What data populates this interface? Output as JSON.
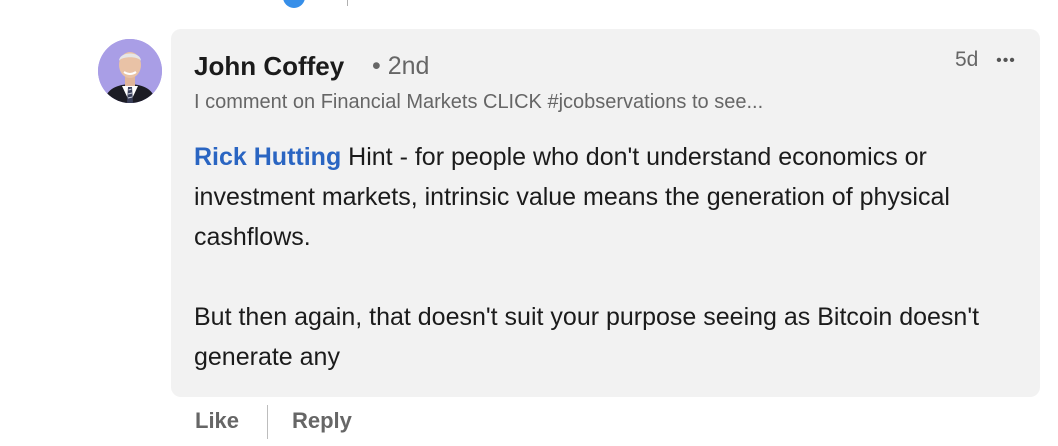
{
  "comment": {
    "author_name": "John Coffey",
    "connection_degree": "• 2nd",
    "headline": "I comment on Financial Markets CLICK #jcobservations to see...",
    "timestamp": "5d",
    "more_icon": "•••",
    "mention": "Rick Hutting",
    "body_line_1": " Hint - for people who don't understand economics or investment markets, intrinsic value means the generation of physical cashflows.",
    "body_line_2": "But then again, that doesn't suit your purpose seeing as Bitcoin doesn't generate any"
  },
  "actions": {
    "like_label": "Like",
    "reply_label": "Reply"
  },
  "colors": {
    "mention": "#2a65c2",
    "card_background": "#f2f2f2",
    "avatar_background": "#a99ee6",
    "reaction_icon": "#378fe9"
  }
}
